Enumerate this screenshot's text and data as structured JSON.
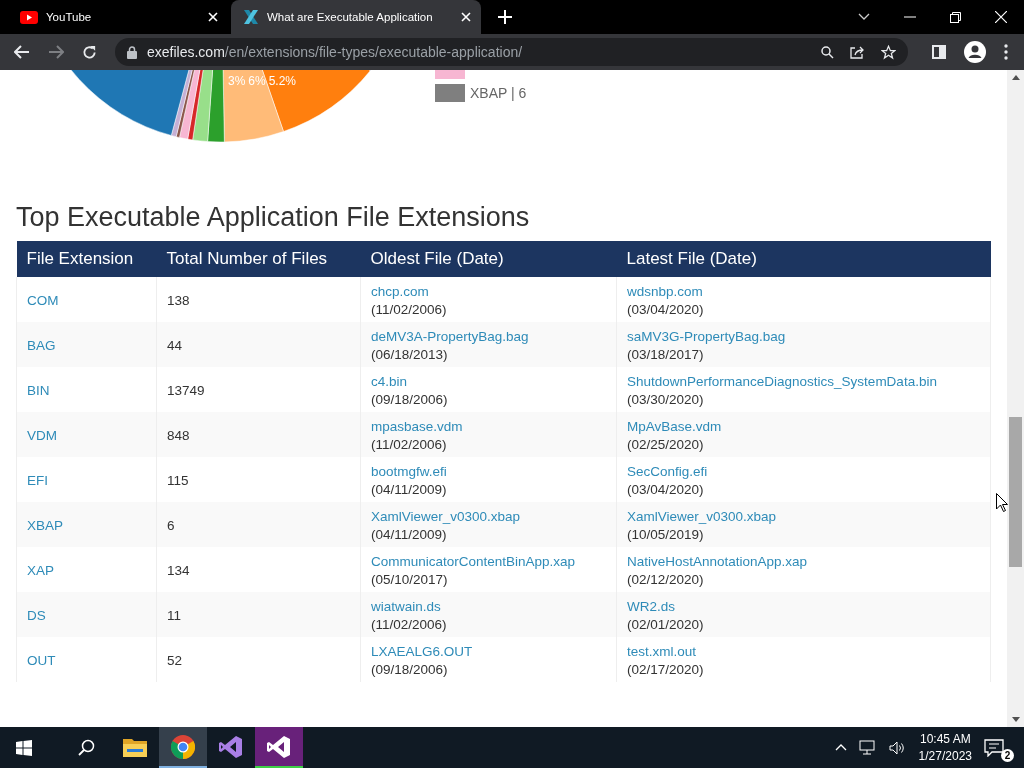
{
  "browser": {
    "tabs": [
      {
        "kind": "youtube",
        "title": "YouTube",
        "selected": false
      },
      {
        "kind": "site",
        "title": "What are Executable Application",
        "selected": true
      }
    ],
    "url": {
      "domain": "exefiles.com",
      "path": "/en/extensions/file-types/executable-application/"
    }
  },
  "pie": {
    "labels": [
      "3%",
      "6%",
      "5.2%"
    ],
    "legend": [
      {
        "color": "#f7b6d2"
      },
      {
        "label": "XBAP | 6",
        "color": "#7f7f7f"
      }
    ]
  },
  "heading": "Top Executable Application File Extensions",
  "table": {
    "columns": [
      "File Extension",
      "Total Number of Files",
      "Oldest File (Date)",
      "Latest File (Date)"
    ],
    "rows": [
      {
        "extension": "COM",
        "total": "138",
        "oldest": {
          "file": "chcp.com",
          "date": "(11/02/2006)"
        },
        "latest": {
          "file": "wdsnbp.com",
          "date": "(03/04/2020)"
        }
      },
      {
        "extension": "BAG",
        "total": "44",
        "oldest": {
          "file": "deMV3A-PropertyBag.bag",
          "date": "(06/18/2013)"
        },
        "latest": {
          "file": "saMV3G-PropertyBag.bag",
          "date": "(03/18/2017)"
        }
      },
      {
        "extension": "BIN",
        "total": "13749",
        "oldest": {
          "file": "c4.bin",
          "date": "(09/18/2006)"
        },
        "latest": {
          "file": "ShutdownPerformanceDiagnostics_SystemData.bin",
          "date": "(03/30/2020)"
        }
      },
      {
        "extension": "VDM",
        "total": "848",
        "oldest": {
          "file": "mpasbase.vdm",
          "date": "(11/02/2006)"
        },
        "latest": {
          "file": "MpAvBase.vdm",
          "date": "(02/25/2020)"
        }
      },
      {
        "extension": "EFI",
        "total": "115",
        "oldest": {
          "file": "bootmgfw.efi",
          "date": "(04/11/2009)"
        },
        "latest": {
          "file": "SecConfig.efi",
          "date": "(03/04/2020)"
        }
      },
      {
        "extension": "XBAP",
        "total": "6",
        "oldest": {
          "file": "XamlViewer_v0300.xbap",
          "date": "(04/11/2009)"
        },
        "latest": {
          "file": "XamlViewer_v0300.xbap",
          "date": "(10/05/2019)"
        }
      },
      {
        "extension": "XAP",
        "total": "134",
        "oldest": {
          "file": "CommunicatorContentBinApp.xap",
          "date": "(05/10/2017)"
        },
        "latest": {
          "file": "NativeHostAnnotationApp.xap",
          "date": "(02/12/2020)"
        }
      },
      {
        "extension": "DS",
        "total": "11",
        "oldest": {
          "file": "wiatwain.ds",
          "date": "(11/02/2006)"
        },
        "latest": {
          "file": "WR2.ds",
          "date": "(02/01/2020)"
        }
      },
      {
        "extension": "OUT",
        "total": "52",
        "oldest": {
          "file": "LXAEALG6.OUT",
          "date": "(09/18/2006)"
        },
        "latest": {
          "file": "test.xml.out",
          "date": "(02/17/2020)"
        }
      }
    ]
  },
  "taskbar": {
    "apps": [
      {
        "kind": "folder",
        "selected": false
      },
      {
        "kind": "chrome",
        "selected": true
      },
      {
        "kind": "vs-purple",
        "selected": false
      },
      {
        "kind": "vs-code",
        "selected": true
      }
    ],
    "time": "10:45 AM",
    "date": "1/27/2023",
    "notifications": "2"
  }
}
